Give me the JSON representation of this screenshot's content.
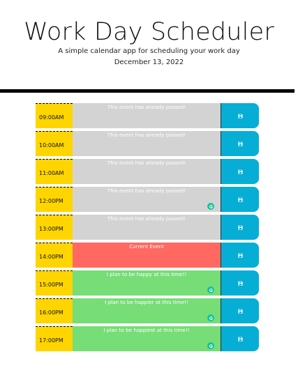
{
  "header": {
    "title": "Work Day Scheduler",
    "subtitle": "A simple calendar app for scheduling your work day",
    "date": "December 13, 2022"
  },
  "rows": [
    {
      "hour": "09:00AM",
      "text": "This event has already passed!",
      "state": "past",
      "badge": false
    },
    {
      "hour": "10:00AM",
      "text": "This event has already passed!",
      "state": "past",
      "badge": false
    },
    {
      "hour": "11:00AM",
      "text": "This event has already passed!",
      "state": "past",
      "badge": false
    },
    {
      "hour": "12:00PM",
      "text": "This event has already passed!",
      "state": "past",
      "badge": true
    },
    {
      "hour": "13:00PM",
      "text": "This event has already passed!",
      "state": "past",
      "badge": false
    },
    {
      "hour": "14:00PM",
      "text": "Current Event",
      "state": "present",
      "badge": false
    },
    {
      "hour": "15:00PM",
      "text": "I plan to be happy at this time!!",
      "state": "future",
      "badge": true
    },
    {
      "hour": "16:00PM",
      "text": "I plan to be happier at this time!!",
      "state": "future",
      "badge": true
    },
    {
      "hour": "17:00PM",
      "text": "I plan to be happiest at this time!!",
      "state": "future",
      "badge": true
    }
  ],
  "icons": {
    "save": "floppy-disk-icon",
    "badge": "grammarly-icon"
  },
  "colors": {
    "hour": "#ffd500",
    "past": "#d3d3d3",
    "present": "#ff6961",
    "future": "#77dd77",
    "save": "#06aed5"
  }
}
